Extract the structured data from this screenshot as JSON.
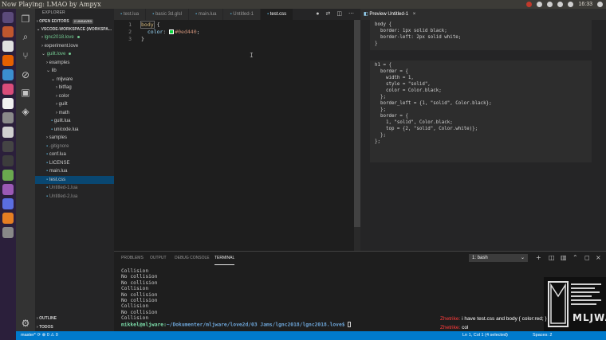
{
  "top_bar": {
    "now_playing": "Now Playing:   LMAO by Ampyx",
    "time": "16:33"
  },
  "sidebar": {
    "title": "EXPLORER",
    "open_editors": "OPEN EDITORS",
    "unsaved_badge": "2 UNSAVED",
    "workspace": "VSCODE-WORKSPACE (WORKSPA...",
    "tree": [
      {
        "label": "lgnc2018.love",
        "depth": 0,
        "arrow": "›",
        "modified": true
      },
      {
        "label": "experiment.love",
        "depth": 0,
        "arrow": "›",
        "modified": false
      },
      {
        "label": "guilt.love",
        "depth": 0,
        "arrow": "⌄",
        "modified": true
      },
      {
        "label": "examples",
        "depth": 1,
        "arrow": "›",
        "modified": false
      },
      {
        "label": "lib",
        "depth": 1,
        "arrow": "⌄",
        "modified": false
      },
      {
        "label": "mljware",
        "depth": 2,
        "arrow": "⌄",
        "modified": false
      },
      {
        "label": "bitflag",
        "depth": 3,
        "arrow": "›",
        "modified": false
      },
      {
        "label": "color",
        "depth": 3,
        "arrow": "›",
        "modified": false
      },
      {
        "label": "guilt",
        "depth": 3,
        "arrow": "›",
        "modified": false
      },
      {
        "label": "math",
        "depth": 3,
        "arrow": "›",
        "modified": false
      },
      {
        "label": "guilt.lua",
        "depth": 2,
        "arrow": "",
        "modified": false
      },
      {
        "label": "unicode.lua",
        "depth": 2,
        "arrow": "",
        "modified": false
      },
      {
        "label": "samples",
        "depth": 1,
        "arrow": "›",
        "modified": false
      },
      {
        "label": ".gitignore",
        "depth": 1,
        "arrow": "",
        "modified": false
      },
      {
        "label": "conf.lua",
        "depth": 1,
        "arrow": "",
        "modified": false
      },
      {
        "label": "LICENSE",
        "depth": 1,
        "arrow": "",
        "modified": false
      },
      {
        "label": "main.lua",
        "depth": 1,
        "arrow": "",
        "modified": false
      },
      {
        "label": "test.css",
        "depth": 1,
        "arrow": "",
        "modified": false
      },
      {
        "label": "Untitled-1.lua",
        "depth": 1,
        "arrow": "",
        "modified": false
      },
      {
        "label": "Untitled-2.lua",
        "depth": 1,
        "arrow": "",
        "modified": false
      }
    ],
    "outline": "OUTLINE",
    "todos": "TODOS"
  },
  "tabs": [
    "test.lua",
    "basic 3d.glsl",
    "main.lua",
    "Untitled-1",
    "test.css"
  ],
  "active_tab_index": 4,
  "editor": {
    "line_numbers": [
      "1",
      "2",
      "3"
    ],
    "selector": "body",
    "open_brace": " {",
    "property": "  color",
    "colon": ": ",
    "value": "#0ed440",
    "semicolon": ";",
    "close_brace": "}",
    "swatch_color": "#0ed440"
  },
  "preview": {
    "tab_label": "Preview Untitled-1",
    "code_block_1": "body {\n  border: 1px solid black;\n  border-left: 2px solid white;\n}",
    "code_block_2": "h1 = {\n  border = {\n    width = 1,\n    style = \"solid\",\n    color = Color.black;\n  };\n  border_left = {1, \"solid\", Color.black};\n  };\n  border = {\n    1, \"solid\", Color.black;\n    top = {2, \"solid\", Color.white)};\n  };\n};"
  },
  "panel": {
    "tabs": [
      "PROBLEMS",
      "OUTPUT",
      "DEBUG CONSOLE",
      "TERMINAL"
    ],
    "active_tab": "TERMINAL",
    "terminal_select": "1: bash",
    "terminal_lines": [
      "Collision",
      "No collision",
      "No collision",
      "Collision",
      "No collision",
      "No collision",
      "Collision",
      "No collision",
      "Collision"
    ],
    "prompt_user": "mikkel@mljware:",
    "prompt_path": "~/Dokumenter/mljware/love2d/03 Jams/lgnc2018/lgnc2018.love$ "
  },
  "status_bar": {
    "branch": "master*",
    "sync": "⟳",
    "errors": "⊗ 0 ⚠ 0",
    "position": "Ln 1, Col 1 (4 selected)",
    "spaces": "Spaces: 2",
    "encoding": "UTF-8",
    "eol": "LF",
    "language": "CSS"
  },
  "overlay": {
    "logo_text": "MLJWARE",
    "chat": [
      {
        "name": "Zhetrike:",
        "message": "i have test.css and body { color:red; }"
      },
      {
        "name": "Zhetrike:",
        "message": "col"
      }
    ]
  },
  "colors": {
    "accent": "#007acc",
    "launcher": "#2b1f3b",
    "chat_name": "#ff3b3b",
    "prompt": "#7ee1ad"
  }
}
